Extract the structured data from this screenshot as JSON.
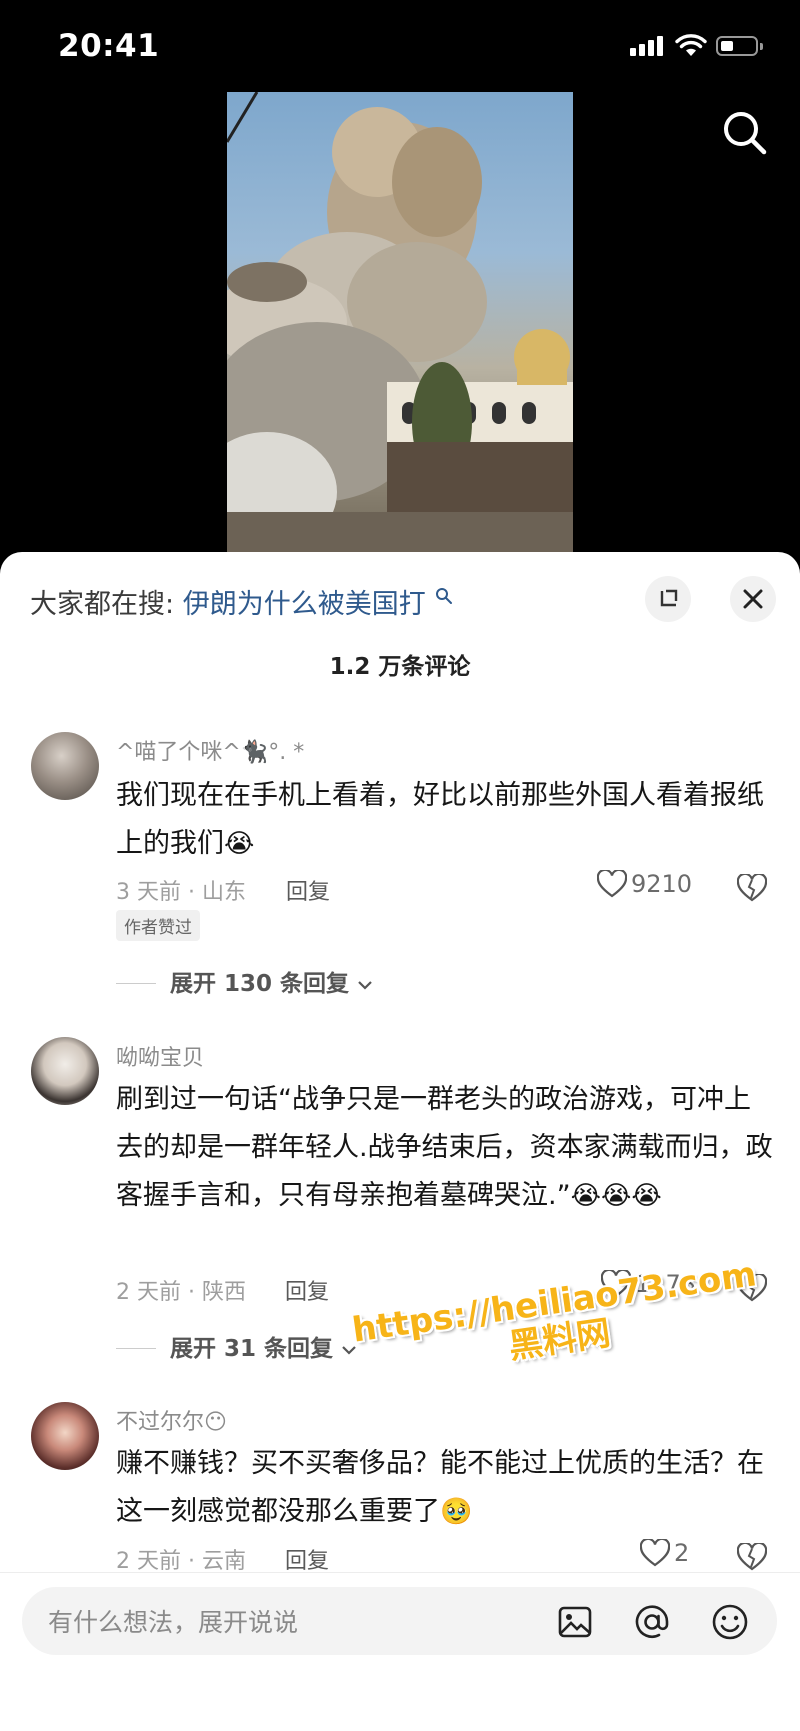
{
  "status_bar": {
    "time": "20:41"
  },
  "hot_search": {
    "prefix": "大家都在搜:",
    "keyword": "伊朗为什么被美国打"
  },
  "comment_count": "1.2 万条评论",
  "comments": [
    {
      "username": "^喵了个咪^🐈‍⬛°. *",
      "text": "我们现在在手机上看着，好比以前那些外国人看着报纸上的我们",
      "emoji": "😭",
      "time_location": "3 天前 · 山东",
      "reply_label": "回复",
      "likes": "9210",
      "badge": "作者赞过",
      "expand_replies": "展开 130 条回复"
    },
    {
      "username": "呦呦宝贝",
      "text": "刷到过一句话“战争只是一群老头的政治游戏，可冲上去的却是一群年轻人.战争结束后，资本家满载而归，政客握手言和，只有母亲抱着墓碑哭泣.”",
      "emoji": "😭😭😭",
      "time_location": "2 天前 · 陕西",
      "reply_label": "回复",
      "likes": "1173",
      "expand_replies": "展开 31 条回复"
    },
    {
      "username": "不过尔尔",
      "username_emoji": "😶",
      "text": "赚不赚钱？买不买奢侈品？能不能过上优质的生活？在这一刻感觉都没那么重要了",
      "emoji": "🥹",
      "time_location": "2 天前 · 云南",
      "reply_label": "回复",
      "likes": "2"
    }
  ],
  "watermark": {
    "line1": "https://heiliao73.com",
    "line2": "黑料网"
  },
  "input": {
    "placeholder": "有什么想法，展开说说"
  },
  "icons": [
    "search-icon",
    "expand-icon",
    "close-icon",
    "heart-icon",
    "dislike-icon",
    "image-icon",
    "at-icon",
    "emoji-icon"
  ]
}
